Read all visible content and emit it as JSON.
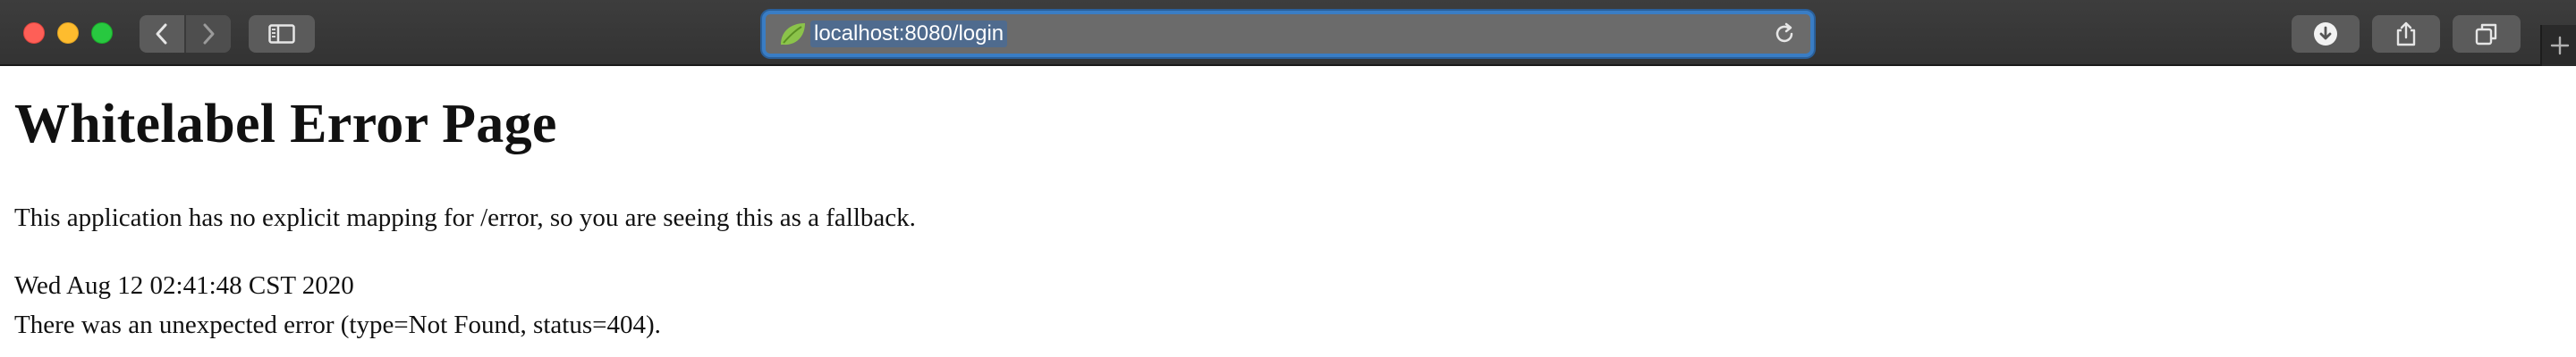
{
  "browser": {
    "url": "localhost:8080/login",
    "icons": {
      "back": "chevron-left-icon",
      "forward": "chevron-right-icon",
      "sidebar": "sidebar-icon",
      "favicon": "spring-leaf-icon",
      "reload": "reload-icon",
      "downloads": "download-icon",
      "share": "share-icon",
      "tabs": "tab-overview-icon",
      "new_tab": "plus-icon"
    },
    "colors": {
      "toolbar": "#383838",
      "address_focus": "#3a7dc4",
      "close": "#fe5f57",
      "minimize": "#febc2e",
      "zoom": "#28c840"
    }
  },
  "page": {
    "title": "Whitelabel Error Page",
    "message": "This application has no explicit mapping for /error, so you are seeing this as a fallback.",
    "timestamp": "Wed Aug 12 02:41:48 CST 2020",
    "error": "There was an unexpected error (type=Not Found, status=404)."
  }
}
